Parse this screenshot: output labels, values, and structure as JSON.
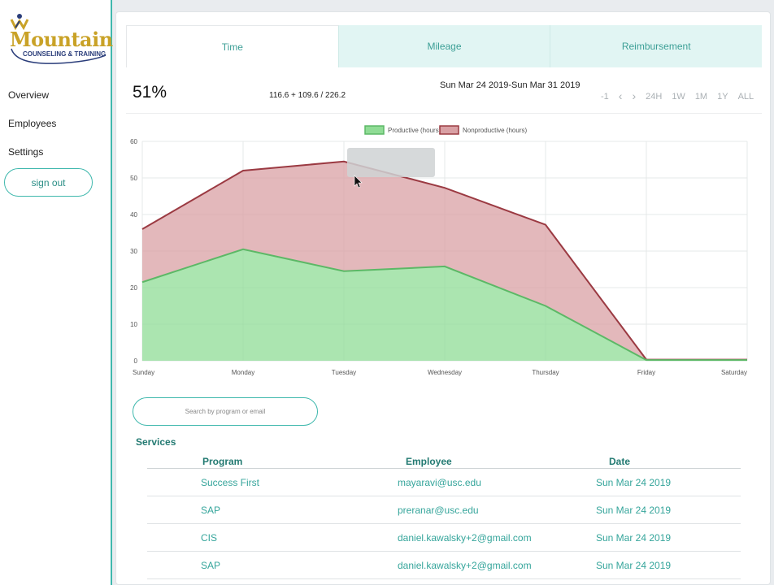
{
  "sidebar": {
    "logo": {
      "main": "Mountain",
      "sub": "COUNSELING & TRAINING"
    },
    "items": [
      {
        "label": "Overview"
      },
      {
        "label": "Employees"
      },
      {
        "label": "Settings"
      }
    ],
    "sign_out": "sign out"
  },
  "tabs": [
    {
      "label": "Time",
      "active": true
    },
    {
      "label": "Mileage",
      "active": false
    },
    {
      "label": "Reimbursement",
      "active": false
    }
  ],
  "summary": {
    "percent": "51%",
    "ratio": "116.6 + 109.6 / 226.2",
    "date_range": "Sun Mar 24 2019-Sun Mar 31 2019"
  },
  "range_buttons": [
    "-1",
    "‹",
    "›",
    "24H",
    "1W",
    "1M",
    "1Y",
    "ALL"
  ],
  "chart_data": {
    "type": "area",
    "stacked": true,
    "x": [
      "Sunday",
      "Monday",
      "Tuesday",
      "Wednesday",
      "Thursday",
      "Friday",
      "Saturday"
    ],
    "series": [
      {
        "name": "Productive (hours)",
        "values": [
          21.5,
          30.5,
          24.5,
          25.8,
          15,
          0.2,
          0.2
        ],
        "color": "#8fdc95"
      },
      {
        "name": "Nonproductive (hours)",
        "values": [
          14.5,
          21.5,
          30,
          21.5,
          22.2,
          0.1,
          0.1
        ],
        "color": "#d9a0a4"
      }
    ],
    "ylim": [
      0,
      60
    ],
    "yticks": [
      0,
      10,
      20,
      30,
      40,
      50,
      60
    ],
    "grid": true,
    "legend": "top-center"
  },
  "search": {
    "placeholder": "Search by program or email"
  },
  "services": {
    "title": "Services",
    "columns": [
      "Program",
      "Employee",
      "Date"
    ],
    "rows": [
      {
        "program": "Success First",
        "employee": "mayaravi@usc.edu",
        "date": "Sun Mar 24 2019"
      },
      {
        "program": "SAP",
        "employee": "preranar@usc.edu",
        "date": "Sun Mar 24 2019"
      },
      {
        "program": "CIS",
        "employee": "daniel.kawalsky+2@gmail.com",
        "date": "Sun Mar 24 2019"
      },
      {
        "program": "SAP",
        "employee": "daniel.kawalsky+2@gmail.com",
        "date": "Sun Mar 24 2019"
      }
    ]
  },
  "colors": {
    "accent": "#3fb8ad",
    "productive_line": "#5cb866",
    "nonproductive_line": "#9b3a42"
  }
}
